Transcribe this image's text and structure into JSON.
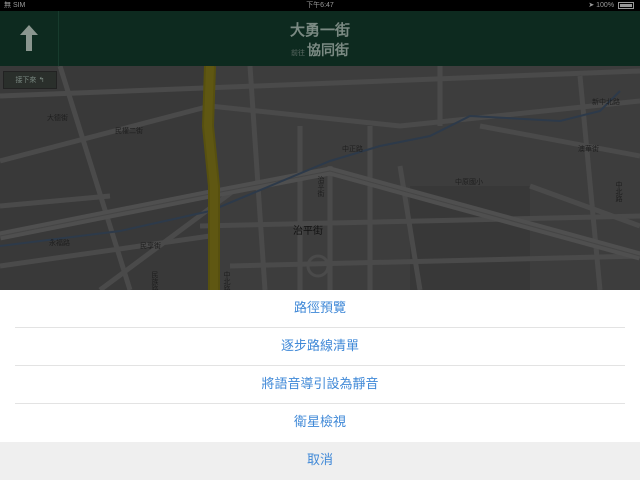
{
  "status_bar": {
    "carrier": "無 SIM",
    "time": "下午6:47",
    "battery": "100%"
  },
  "navigation": {
    "main_road": "大勇一街",
    "toward_label": "前往",
    "toward_road": "協同街"
  },
  "next_turn_chip": "接下來",
  "map_labels": {
    "l1": "大德街",
    "l2": "民權二街",
    "l3": "中正路",
    "l4": "中原國小",
    "l5": "澳華街",
    "l6": "新中北路",
    "l7": "中北路",
    "l8": "治平街",
    "l9": "民享街",
    "l10": "中北路",
    "l11": "永福路",
    "l12": "治平街",
    "l13": "民族路"
  },
  "action_sheet": {
    "items": [
      "路徑預覽",
      "逐步路線清單",
      "將語音導引設為靜音",
      "衛星檢視"
    ],
    "cancel": "取消"
  }
}
